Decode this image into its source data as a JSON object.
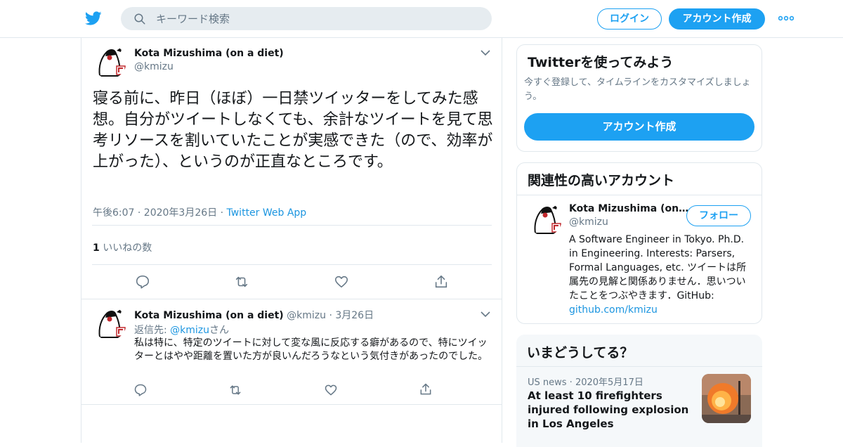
{
  "header": {
    "search_placeholder": "キーワード検索",
    "login_label": "ログイン",
    "signup_label": "アカウント作成",
    "brand_color": "#1da1f2"
  },
  "tweet": {
    "author_name": "Kota Mizushima (on a diet)",
    "author_handle": "@kmizu",
    "text": "寝る前に、昨日（ほぼ）一日禁ツイッターをしてみた感想。自分がツイートしなくても、余計なツイートを見て思考リソースを割いていたことが実感できた（ので、効率が上がった）、というのが正直なところです。",
    "timestamp": "午後6:07 · 2020年3月26日",
    "separator": "·",
    "source": "Twitter Web App",
    "like_count": "1",
    "like_label": "いいねの数"
  },
  "reply": {
    "author_name": "Kota Mizushima (on a diet)",
    "author_handle": "@kmizu",
    "date": "· 3月26日",
    "reply_to_prefix": "返信先: ",
    "reply_to_handle": "@kmizu",
    "reply_to_suffix": "さん",
    "text": "私は特に、特定のツイートに対して変な風に反応する癖があるので、特にツイッターとはやや距離を置いた方が良いんだろうなという気付きがあったのでした。"
  },
  "signup_card": {
    "title": "Twitterを使ってみよう",
    "subtitle": "今すぐ登録して、タイムラインをカスタマイズしましょう。",
    "button": "アカウント作成"
  },
  "related_card": {
    "title": "関連性の高いアカウント",
    "name": "Kota Mizushima (on…",
    "handle": "@kmizu",
    "follow_label": "フォロー",
    "bio": "A Software Engineer in Tokyo. Ph.D. in Engineering. Interests: Parsers, Formal Languages, etc. ツイートは所属先の見解と関係ありません．思いついたことをつぶやきます．GitHub:",
    "bio_link": "github.com/kmizu"
  },
  "trends_card": {
    "title": "いまどうしてる？",
    "item_meta": "US news · 2020年5月17日",
    "item_title": "At least 10 firefighters injured following explosion in Los Angeles"
  }
}
